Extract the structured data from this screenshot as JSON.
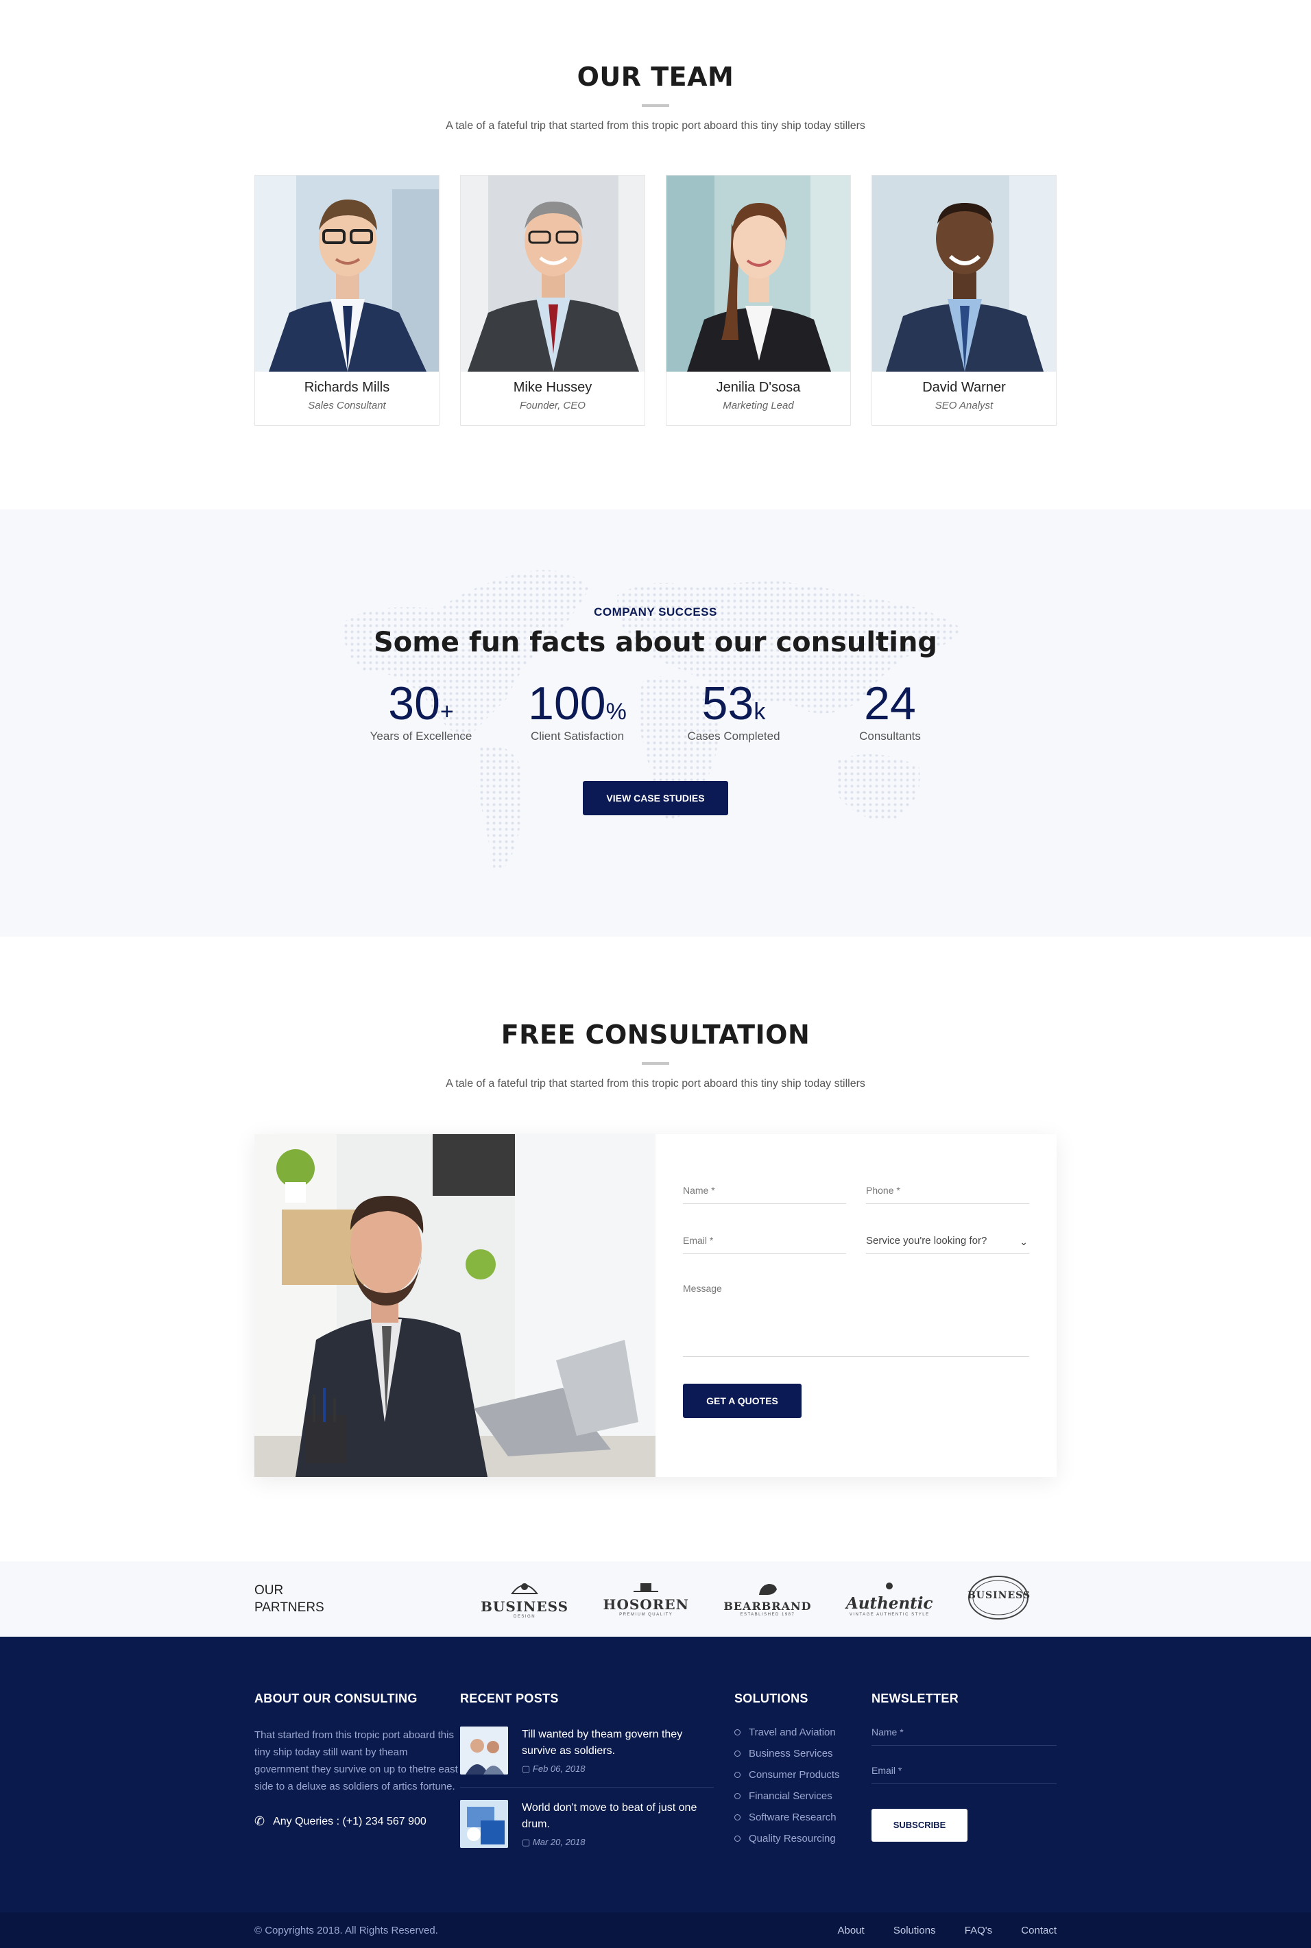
{
  "team": {
    "title": "OUR TEAM",
    "subtitle": "A tale of a fateful trip that started from this tropic port aboard this tiny ship today stillers",
    "members": [
      {
        "name": "Richards Mills",
        "role": "Sales Consultant"
      },
      {
        "name": "Mike Hussey",
        "role": "Founder, CEO"
      },
      {
        "name": "Jenilia D'sosa",
        "role": "Marketing Lead"
      },
      {
        "name": "David Warner",
        "role": "SEO Analyst"
      }
    ]
  },
  "facts": {
    "kicker": "COMPANY SUCCESS",
    "title": "Some fun facts about our consulting",
    "stats": [
      {
        "value": "30",
        "suffix": "+",
        "label": "Years of Excellence"
      },
      {
        "value": "100",
        "suffix": "%",
        "label": "Client Satisfaction"
      },
      {
        "value": "53",
        "suffix": "k",
        "label": "Cases Completed"
      },
      {
        "value": "24",
        "suffix": "",
        "label": "Consultants"
      }
    ],
    "button": "VIEW CASE STUDIES"
  },
  "consult": {
    "title": "FREE CONSULTATION",
    "subtitle": "A tale of a fateful trip that started from this tropic port aboard this tiny ship today stillers",
    "form": {
      "name": "Name *",
      "phone": "Phone *",
      "email": "Email *",
      "service": "Service you're looking for?",
      "message": "Message",
      "button": "GET A QUOTES"
    }
  },
  "partners": {
    "title_line1": "OUR",
    "title_line2": "PARTNERS",
    "logos": [
      {
        "name": "BUSINESS",
        "tag": "DESIGN"
      },
      {
        "name": "HOSOREN",
        "tag": "PREMIUM QUALITY"
      },
      {
        "name": "BEARBRAND",
        "tag": "ESTABLISHED 1987"
      },
      {
        "name": "Authentic",
        "tag": "VINTAGE AUTHENTIC STYLE"
      },
      {
        "name": "BUSINESS",
        "tag": ""
      }
    ]
  },
  "footer": {
    "about": {
      "title": "ABOUT OUR CONSULTING",
      "text": "That started from this tropic port aboard this tiny ship today still want by theam government they survive on up to thetre east side to a deluxe as soldiers of artics fortune.",
      "queries": "Any Queries : (+1) 234 567 900"
    },
    "posts": {
      "title": "RECENT POSTS",
      "items": [
        {
          "title": "Till wanted by theam govern they survive as soldiers.",
          "date": "Feb 06, 2018"
        },
        {
          "title": "World don't move to beat of just one drum.",
          "date": "Mar 20, 2018"
        }
      ]
    },
    "solutions": {
      "title": "SOLUTIONS",
      "items": [
        "Travel and Aviation",
        "Business Services",
        "Consumer Products",
        "Financial Services",
        "Software Research",
        "Quality Resourcing"
      ]
    },
    "newsletter": {
      "title": "NEWSLETTER",
      "name": "Name *",
      "email": "Email *",
      "button": "SUBSCRIBE"
    }
  },
  "bottom": {
    "copyright": "© Copyrights 2018. All Rights Reserved.",
    "links": [
      "About",
      "Solutions",
      "FAQ's",
      "Contact"
    ]
  },
  "colors": {
    "primary": "#0b1a55",
    "footer": "#0b1a4c",
    "light_bg": "#f6f8fc"
  }
}
